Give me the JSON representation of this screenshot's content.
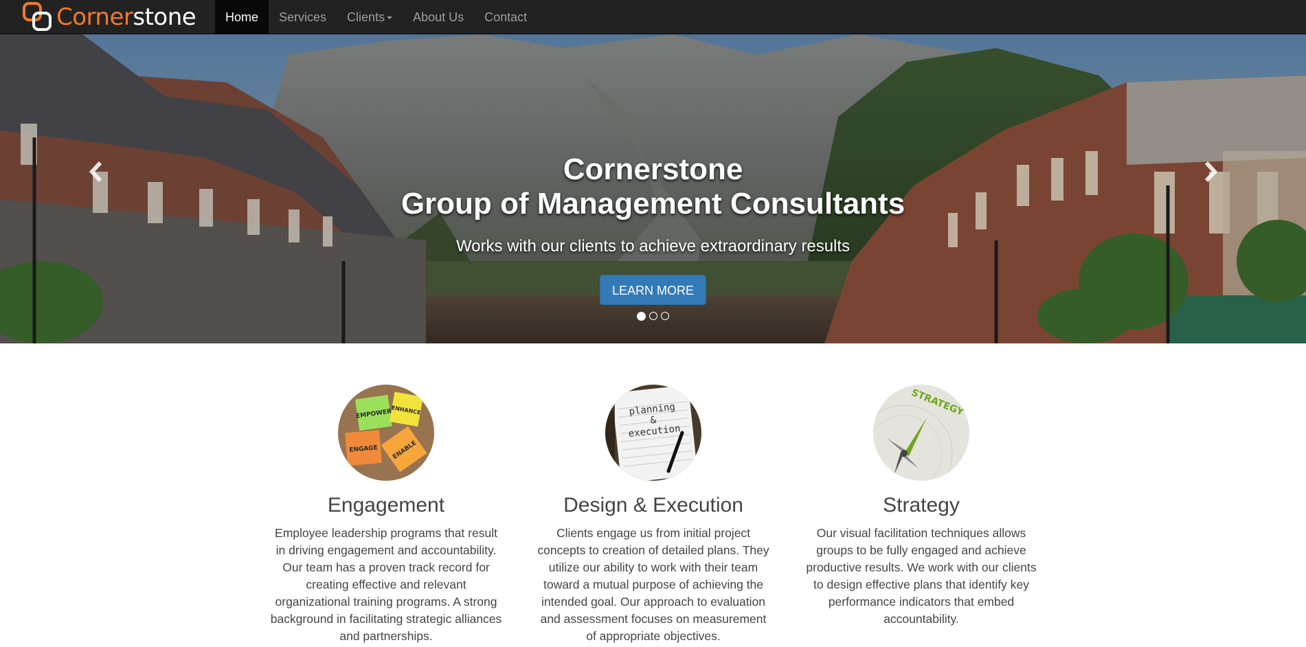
{
  "brand": {
    "name_part1": "Corner",
    "name_part2": "stone",
    "accent_color": "#f07a2a"
  },
  "nav": {
    "items": [
      {
        "label": "Home",
        "active": true
      },
      {
        "label": "Services"
      },
      {
        "label": "Clients",
        "has_dropdown": true
      },
      {
        "label": "About Us"
      },
      {
        "label": "Contact"
      }
    ]
  },
  "carousel": {
    "title_line1": "Cornerstone",
    "title_line2": "Group of Management Consultants",
    "subtitle": "Works with our clients to achieve extraordinary results",
    "button_label": "LEARN MORE",
    "slide_count": 3,
    "active_slide": 1,
    "prev_icon": "chevron-left-icon",
    "next_icon": "chevron-right-icon"
  },
  "features": [
    {
      "title": "Engagement",
      "image": "sticky-notes-image",
      "text": "Employee leadership programs that result in driving engagement and accountability. Our team has a proven track record for creating effective and relevant organizational training programs. A strong background in facilitating strategic alliances and partnerships.",
      "note_words": [
        "EMPOWER",
        "ENHANCE",
        "ENGAGE",
        "ENABLE"
      ]
    },
    {
      "title": "Design & Execution",
      "image": "notebook-image",
      "text": "Clients engage us from initial project concepts to creation of detailed plans. They utilize our ability to work with their team toward a mutual purpose of achieving the intended goal. Our approach to evaluation and assessment focuses on measurement of appropriate objectives.",
      "note_words": [
        "planning",
        "&",
        "execution"
      ]
    },
    {
      "title": "Strategy",
      "image": "compass-image",
      "text": "Our visual facilitation techniques allows groups to be fully engaged and achieve productive results. We work with our clients to design effective plans that identify key performance indicators that embed accountability.",
      "note_words": [
        "STRATEGY"
      ]
    }
  ]
}
